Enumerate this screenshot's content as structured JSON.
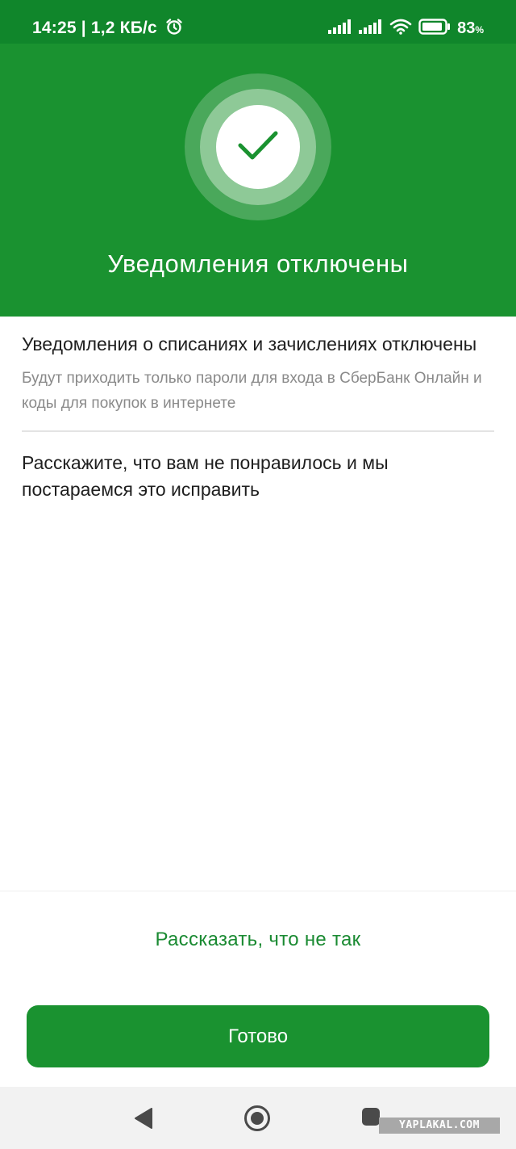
{
  "status_bar": {
    "time_speed": "14:25 | 1,2 КБ/с",
    "battery_percent": "83",
    "battery_unit": "%",
    "icons": [
      "alarm-icon",
      "signal-icon",
      "signal-icon",
      "wifi-icon",
      "battery-icon"
    ]
  },
  "hero": {
    "title": "Уведомления отключены",
    "icon": "checkmark-icon"
  },
  "info": {
    "title": "Уведомления о списаниях и зачислениях отключены",
    "subtitle": "Будут приходить только пароли для входа в СберБанк Онлайн и коды для покупок в интернете"
  },
  "feedback": {
    "prompt": "Расскажите, что вам не понравилось и мы постараемся это исправить",
    "link_label": "Рассказать, что не так"
  },
  "actions": {
    "done_label": "Готово"
  },
  "nav": {
    "icons": [
      "back-icon",
      "home-icon",
      "recents-icon"
    ]
  },
  "watermark": "YAPLAKAL.COM",
  "colors": {
    "status_bar": "#10862b",
    "hero": "#1a9230",
    "accent_text": "#1a8a32",
    "subtitle": "#8a8a8a"
  }
}
